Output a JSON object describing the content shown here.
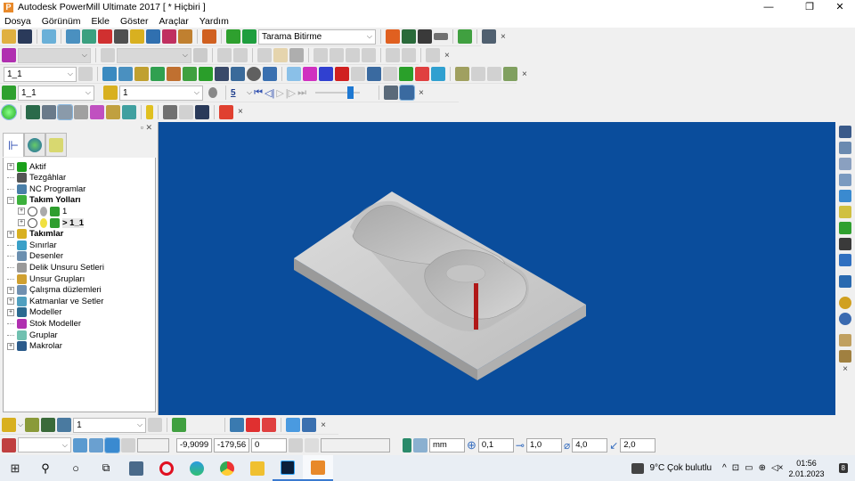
{
  "window": {
    "title": "Autodesk PowerMill Ultimate 2017   [ * Hiçbiri ]",
    "logo": "P",
    "minimize": "—",
    "maximize": "❐",
    "close": "✕"
  },
  "menu": [
    "Dosya",
    "Görünüm",
    "Ekle",
    "Göster",
    "Araçlar",
    "Yardım"
  ],
  "toolbar1": {
    "strategy_combo": "Tarama Bitirme"
  },
  "toolbar3": {
    "toolpath_combo": "1_1"
  },
  "toolbar4": {
    "toolpath_combo": "1_1",
    "tool_combo": "1",
    "step_value": "5"
  },
  "panel": {
    "close": "✕",
    "pin": "▫"
  },
  "tree": [
    {
      "label": "Aktif",
      "bold": false,
      "color": "#1aa01a",
      "expand": "+"
    },
    {
      "label": "Tezgâhlar",
      "bold": false,
      "color": "#555",
      "expand": ""
    },
    {
      "label": "NC Programlar",
      "bold": false,
      "color": "#4a7fa8",
      "expand": ""
    },
    {
      "label": "Takım Yolları",
      "bold": true,
      "color": "#3cb03c",
      "expand": "−"
    },
    {
      "label": "1",
      "bold": false,
      "color": "#2e9e2e",
      "expand": "+",
      "indent": 1
    },
    {
      "label": "> 1_1",
      "bold": true,
      "color": "#2e9e2e",
      "expand": "+",
      "indent": 1
    },
    {
      "label": "Takımlar",
      "bold": true,
      "color": "#d8b020",
      "expand": "+"
    },
    {
      "label": "Sınırlar",
      "bold": false,
      "color": "#3aa0c8",
      "expand": ""
    },
    {
      "label": "Desenler",
      "bold": false,
      "color": "#6a8fb0",
      "expand": ""
    },
    {
      "label": "Delik Unsuru Setleri",
      "bold": false,
      "color": "#999",
      "expand": ""
    },
    {
      "label": "Unsur Grupları",
      "bold": false,
      "color": "#d0a030",
      "expand": ""
    },
    {
      "label": "Çalışma düzlemleri",
      "bold": false,
      "color": "#7090b0",
      "expand": "+"
    },
    {
      "label": "Katmanlar ve Setler",
      "bold": false,
      "color": "#50a0c0",
      "expand": "+"
    },
    {
      "label": "Modeller",
      "bold": false,
      "color": "#2a6a90",
      "expand": "+"
    },
    {
      "label": "Stok Modeller",
      "bold": false,
      "color": "#b030b0",
      "expand": ""
    },
    {
      "label": "Gruplar",
      "bold": false,
      "color": "#70c0b0",
      "expand": ""
    },
    {
      "label": "Makrolar",
      "bold": false,
      "color": "#2a5a8a",
      "expand": "+"
    }
  ],
  "bottom1": {
    "tool_combo": "1"
  },
  "bottom2": {
    "x": "-9,9099",
    "y": "-179,56",
    "z": "0",
    "units": "mm",
    "tolerance": "0,1",
    "stepover": "1,0",
    "diameter": "4,0",
    "angle": "2,0"
  },
  "taskbar": {
    "weather": "9°C  Çok bulutlu",
    "time": "01:56",
    "date": "2.01.2023",
    "notif": "8"
  },
  "colors": {
    "viewport": "#0a4d9c",
    "model": "#c8c8c8",
    "tool": "#b01818"
  }
}
